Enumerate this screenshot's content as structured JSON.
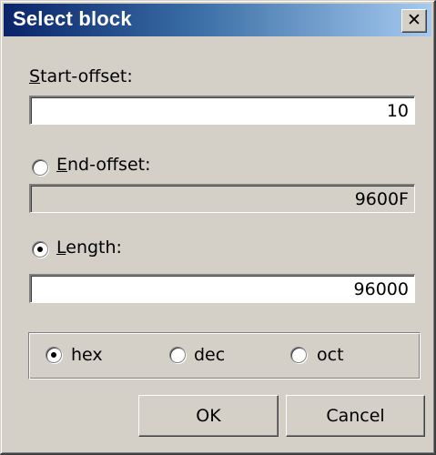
{
  "window": {
    "title": "Select block",
    "close_glyph": "✕"
  },
  "start_offset": {
    "label_mnemonic": "S",
    "label_rest": "tart-offset:",
    "value": "10"
  },
  "end_offset": {
    "label_mnemonic": "E",
    "label_rest": "nd-offset:",
    "value": "9600F",
    "selected": false,
    "enabled": false
  },
  "length": {
    "label_mnemonic": "L",
    "label_rest": "ength:",
    "value": "96000",
    "selected": true
  },
  "base": {
    "options": [
      {
        "label": "hex",
        "selected": true
      },
      {
        "label": "dec",
        "selected": false
      },
      {
        "label": "oct",
        "selected": false
      }
    ]
  },
  "buttons": {
    "ok": "OK",
    "cancel": "Cancel"
  }
}
